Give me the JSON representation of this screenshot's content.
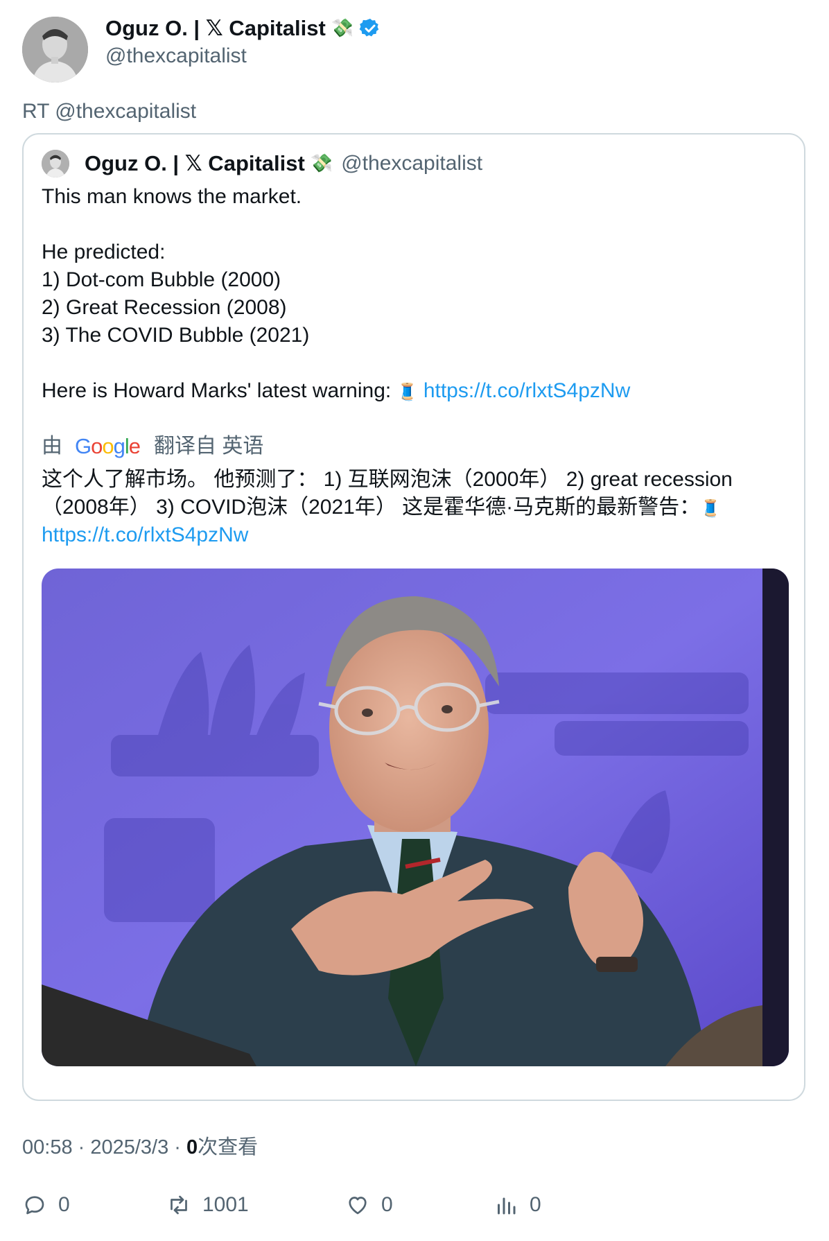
{
  "author": {
    "name": "Oguz O. | 𝕏 Capitalist",
    "emoji": "💸",
    "handle": "@thexcapitalist",
    "verified": true
  },
  "retweet_label": "RT @thexcapitalist",
  "quoted": {
    "name": "Oguz O. | 𝕏 Capitalist",
    "emoji": "💸",
    "handle": "@thexcapitalist",
    "lines": [
      "This man knows the market.",
      "",
      "He predicted:",
      "1) Dot-com Bubble (2000)",
      "2) Great Recession (2008)",
      "3) The COVID Bubble (2021)",
      ""
    ],
    "warning_text": "Here is Howard Marks' latest warning:",
    "thread_emoji": "🧵",
    "link": "https://t.co/rlxtS4pzNw",
    "translate": {
      "prefix": "由",
      "brand": "Google",
      "suffix": "翻译自 英语"
    },
    "translated_line1": "这个人了解市场。 他预测了： 1) 互联网泡沫（2000年） 2) great recession",
    "translated_line2": "（2008年） 3) COVID泡沫（2021年） 这是霍华德·马克斯的最新警告：",
    "translated_link": "https://t.co/rlxtS4pzNw"
  },
  "meta": {
    "time": "00:58 · 2025/3/3 · ",
    "views_count": "0",
    "views_label": "次查看"
  },
  "actions": {
    "replies": "0",
    "retweets": "1001",
    "likes": "0",
    "views": "0"
  },
  "colors": {
    "link": "#1d9bf0",
    "muted": "#536471",
    "verified": "#1d9bf0",
    "border": "#cfd9de"
  }
}
